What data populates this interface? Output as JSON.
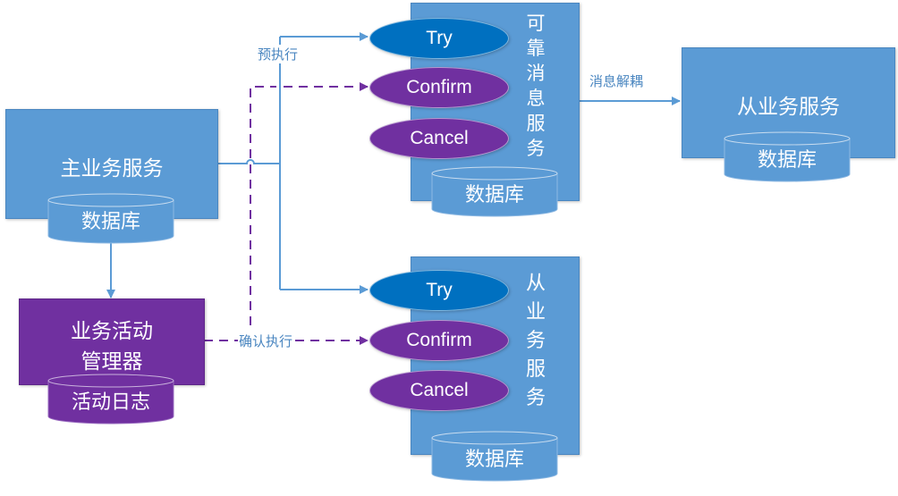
{
  "diagram": {
    "main_service": {
      "title": "主业务服务",
      "db": "数据库"
    },
    "activity_manager": {
      "title_line1": "业务活动",
      "title_line2": "管理器",
      "log": "活动日志"
    },
    "reliable_msg_service": {
      "title": "可靠消息服务",
      "db": "数据库",
      "ops": {
        "try": "Try",
        "confirm": "Confirm",
        "cancel": "Cancel"
      }
    },
    "slave_service_right": {
      "title": "从业务服务",
      "db": "数据库"
    },
    "slave_service_bottom": {
      "title": "从业务服务",
      "db": "数据库",
      "ops": {
        "try": "Try",
        "confirm": "Confirm",
        "cancel": "Cancel"
      }
    },
    "edges": {
      "pre_execute": "预执行",
      "confirm_execute": "确认执行",
      "decouple": "消息解耦"
    },
    "colors": {
      "service_blue": "#5b9bd5",
      "try_blue": "#0070c0",
      "purple": "#7030a0",
      "line_blue": "#5b9bd5"
    }
  }
}
